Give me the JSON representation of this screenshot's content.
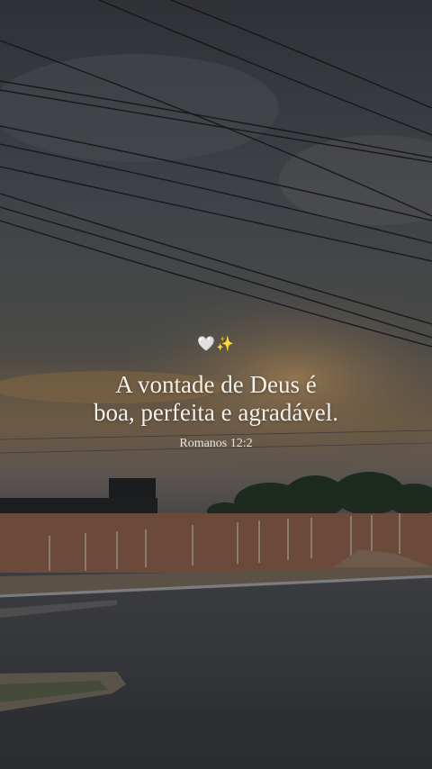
{
  "overlay": {
    "emoji": "🤍✨",
    "quote_line_1": "A vontade de Deus é",
    "quote_line_2": "boa, perfeita e agradável.",
    "reference": "Romanos 12:2"
  }
}
